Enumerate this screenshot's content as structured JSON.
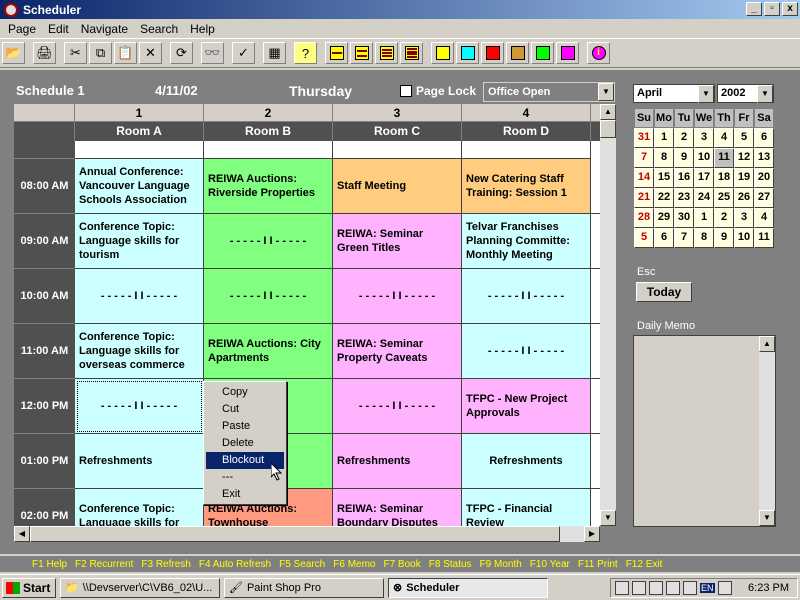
{
  "window": {
    "title": "Scheduler",
    "controls": [
      "_",
      "▫",
      "x"
    ]
  },
  "menu": [
    "Page",
    "Edit",
    "Navigate",
    "Search",
    "Help"
  ],
  "toolbar": {
    "icons": [
      "open-icon",
      "print-icon",
      "cut-icon",
      "copy-icon",
      "paste-icon",
      "delete-icon",
      "refresh-icon",
      "search-binoculars-icon",
      "check-icon",
      "grid-icon",
      "help-icon",
      "align-1-icon",
      "align-2-icon",
      "align-3-icon",
      "align-4-icon"
    ],
    "colors": [
      "#ffff00",
      "#00ffff",
      "#ff0000",
      "#cc9933",
      "#00ff00",
      "#ff00ff"
    ]
  },
  "header": {
    "schedule": "Schedule 1",
    "date": "4/11/02",
    "day": "Thursday",
    "page_lock": "Page Lock",
    "filter": "Office Open"
  },
  "columns": [
    {
      "num": "1",
      "room": "Room A"
    },
    {
      "num": "2",
      "room": "Room B"
    },
    {
      "num": "3",
      "room": "Room C"
    },
    {
      "num": "4",
      "room": "Room D"
    }
  ],
  "times": [
    "08:00 AM",
    "09:00 AM",
    "10:00 AM",
    "11:00 AM",
    "12:00 PM",
    "01:00 PM",
    "02:00 PM"
  ],
  "rows": [
    [
      "Annual Conference: Vancouver Language Schools Association",
      "REIWA Auctions: Riverside Properties",
      "Staff Meeting",
      "New Catering Staff Training: Session 1"
    ],
    [
      "Conference Topic: Language skills for tourism",
      "- - - - - I I - - - - -",
      "REIWA: Seminar Green Titles",
      "Telvar Franchises Planning Committe: Monthly Meeting"
    ],
    [
      "- - - - - I I - - - - -",
      "- - - - - I I - - - - -",
      "- - - - - I I - - - - -",
      "- - - - - I I - - - - -"
    ],
    [
      "Conference Topic: Language skills for overseas commerce",
      "REIWA Auctions: City Apartments",
      "REIWA: Seminar Property Caveats",
      "- - - - - I I - - - - -"
    ],
    [
      "- - - - - I I - - - - -",
      "",
      "- - - - - I I - - - - -",
      "TFPC - New Project Approvals"
    ],
    [
      "Refreshments",
      "",
      "Refreshments",
      "Refreshments"
    ],
    [
      "Conference Topic: Language skills for",
      "REIWA Auctions: Townhouse",
      "REIWA: Seminar Boundary Disputes",
      "TFPC - Financial Review"
    ]
  ],
  "context_menu": [
    "Copy",
    "Cut",
    "Paste",
    "Delete",
    "Blockout",
    "---",
    "Exit"
  ],
  "calendar": {
    "month": "April",
    "year": "2002",
    "weekdays": [
      "Su",
      "Mo",
      "Tu",
      "We",
      "Th",
      "Fr",
      "Sa"
    ],
    "weeks": [
      [
        "31",
        "1",
        "2",
        "3",
        "4",
        "5",
        "6"
      ],
      [
        "7",
        "8",
        "9",
        "10",
        "11",
        "12",
        "13"
      ],
      [
        "14",
        "15",
        "16",
        "17",
        "18",
        "19",
        "20"
      ],
      [
        "21",
        "22",
        "23",
        "24",
        "25",
        "26",
        "27"
      ],
      [
        "28",
        "29",
        "30",
        "1",
        "2",
        "3",
        "4"
      ],
      [
        "5",
        "6",
        "7",
        "8",
        "9",
        "10",
        "11"
      ]
    ],
    "selected_day": "11"
  },
  "side": {
    "esc": "Esc",
    "today": "Today",
    "memo_label": "Daily Memo"
  },
  "fkeys": [
    "F1 Help",
    "F2 Recurrent",
    "F3 Refresh",
    "F4 Auto Refresh",
    "F5 Search",
    "F6 Memo",
    "F7 Book",
    "F8 Status",
    "F9 Month",
    "F10 Year",
    "F11 Print",
    "F12 Exit"
  ],
  "taskbar": {
    "start": "Start",
    "tasks": [
      "\\\\Devserver\\C\\VB6_02\\U...",
      "Paint Shop Pro",
      "Scheduler"
    ],
    "lang": "EN",
    "clock": "6:23 PM"
  }
}
